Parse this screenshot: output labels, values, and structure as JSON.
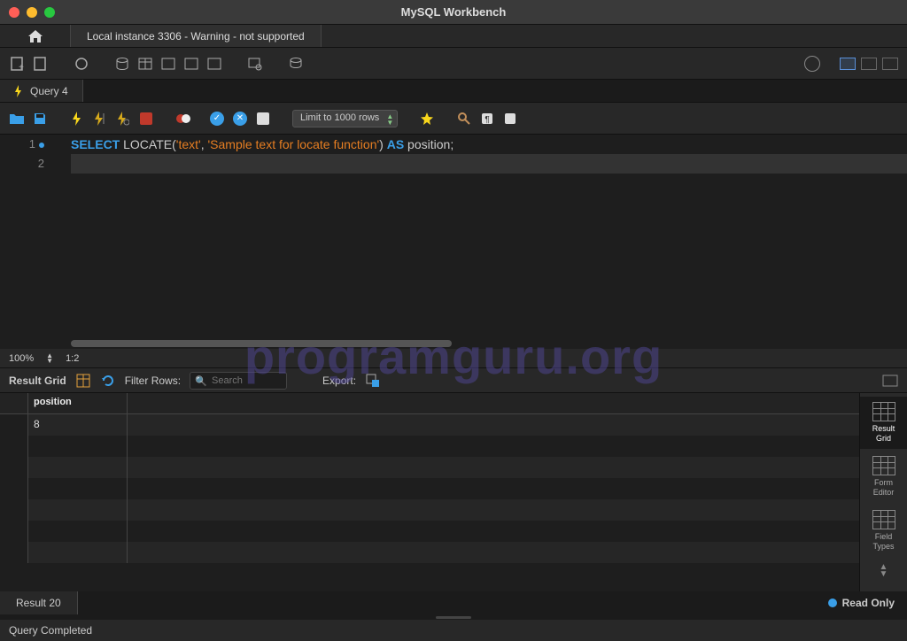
{
  "app_title": "MySQL Workbench",
  "connection_tab": "Local instance 3306 - Warning - not supported",
  "query_tab": {
    "icon": "bolt",
    "label": "Query 4"
  },
  "limit_select": "Limit to 1000 rows",
  "editor": {
    "lines": [
      {
        "n": "1",
        "marker": true,
        "tokens": [
          {
            "t": "SELECT ",
            "c": "kw"
          },
          {
            "t": "LOCATE",
            "c": "fn"
          },
          {
            "t": "(",
            "c": "op"
          },
          {
            "t": "'text'",
            "c": "str"
          },
          {
            "t": ", ",
            "c": "op"
          },
          {
            "t": "'Sample text for locate function'",
            "c": "str"
          },
          {
            "t": ") ",
            "c": "op"
          },
          {
            "t": "AS",
            "c": "kw"
          },
          {
            "t": " position",
            "c": "id"
          },
          {
            "t": ";",
            "c": "op"
          }
        ]
      },
      {
        "n": "2",
        "marker": false,
        "active": true,
        "tokens": []
      }
    ]
  },
  "zoom": {
    "pct": "100%",
    "ratio": "1:2"
  },
  "result_toolbar": {
    "label": "Result Grid",
    "filter_label": "Filter Rows:",
    "filter_placeholder": "Search",
    "export_label": "Export:"
  },
  "grid": {
    "columns": [
      "position"
    ],
    "rows": [
      [
        "8"
      ]
    ]
  },
  "side_panel": [
    {
      "label_a": "Result",
      "label_b": "Grid",
      "active": true
    },
    {
      "label_a": "Form",
      "label_b": "Editor",
      "active": false
    },
    {
      "label_a": "Field",
      "label_b": "Types",
      "active": false
    }
  ],
  "result_tab": "Result 20",
  "read_only": "Read Only",
  "status": "Query Completed",
  "watermark": "programguru.org"
}
